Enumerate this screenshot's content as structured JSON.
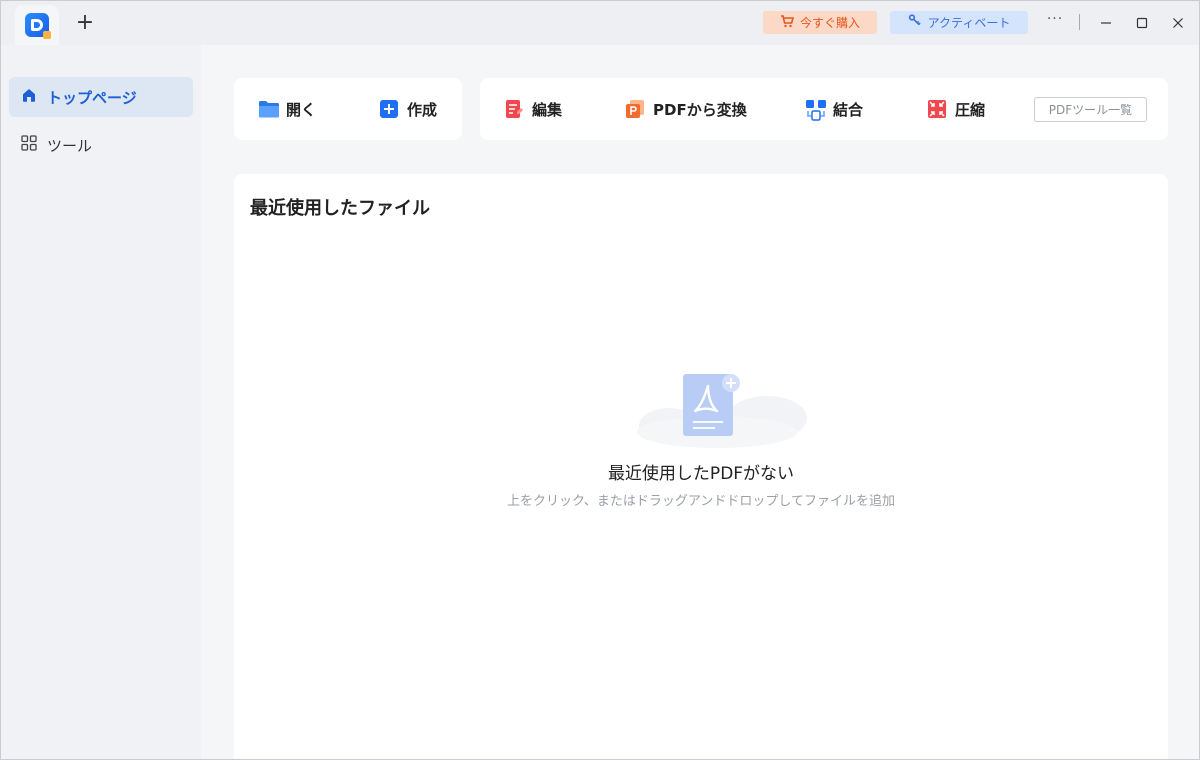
{
  "titlebar": {
    "new_tab": "+",
    "buy_label": "今すぐ購入",
    "activate_label": "アクティベート",
    "more_label": "···"
  },
  "sidebar": {
    "items": [
      {
        "label": "トップページ",
        "icon": "home-icon",
        "active": true
      },
      {
        "label": "ツール",
        "icon": "grid-icon",
        "active": false
      }
    ]
  },
  "quick_actions": [
    {
      "label": "開く",
      "icon": "folder-icon"
    },
    {
      "label": "作成",
      "icon": "plus-square-icon"
    }
  ],
  "tools": [
    {
      "label": "編集",
      "icon": "edit-doc-icon"
    },
    {
      "label": "PDFから変換",
      "icon": "convert-icon"
    },
    {
      "label": "結合",
      "icon": "merge-icon"
    },
    {
      "label": "圧縮",
      "icon": "compress-icon"
    }
  ],
  "tool_list_label": "PDFツール一覧",
  "recent": {
    "title": "最近使用したファイル",
    "empty_title": "最近使用したPDFがない",
    "empty_subtitle": "上をクリック、またはドラッグアンドドロップしてファイルを追加"
  },
  "colors": {
    "accent": "#1f5fd6",
    "buy_bg": "#fcd9c6",
    "buy_text": "#e5561f",
    "activate_bg": "#d3e4fc",
    "activate_text": "#3d6fd8"
  }
}
